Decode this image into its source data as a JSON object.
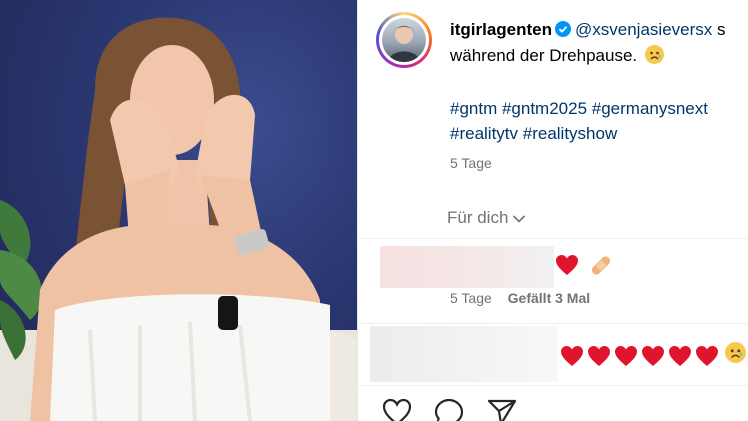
{
  "post": {
    "username": "itgirlagenten",
    "mention": "@xsvenjasieversx",
    "caption_tail": " s",
    "caption_line2": "während der Drehpause.",
    "hashtags_line1": "#gntm #gntm2025 #germanysnext",
    "hashtags_line2": "#realitytv #realityshow",
    "time": "5 Tage"
  },
  "feed_label": "Für dich",
  "comments": [
    {
      "time": "5 Tage",
      "likes": "Gefällt 3 Mal"
    },
    {
      "hearts": 6
    }
  ],
  "colors": {
    "link": "#00376b",
    "muted": "#737373",
    "verified": "#0095f6",
    "heart": "#e0142c"
  }
}
